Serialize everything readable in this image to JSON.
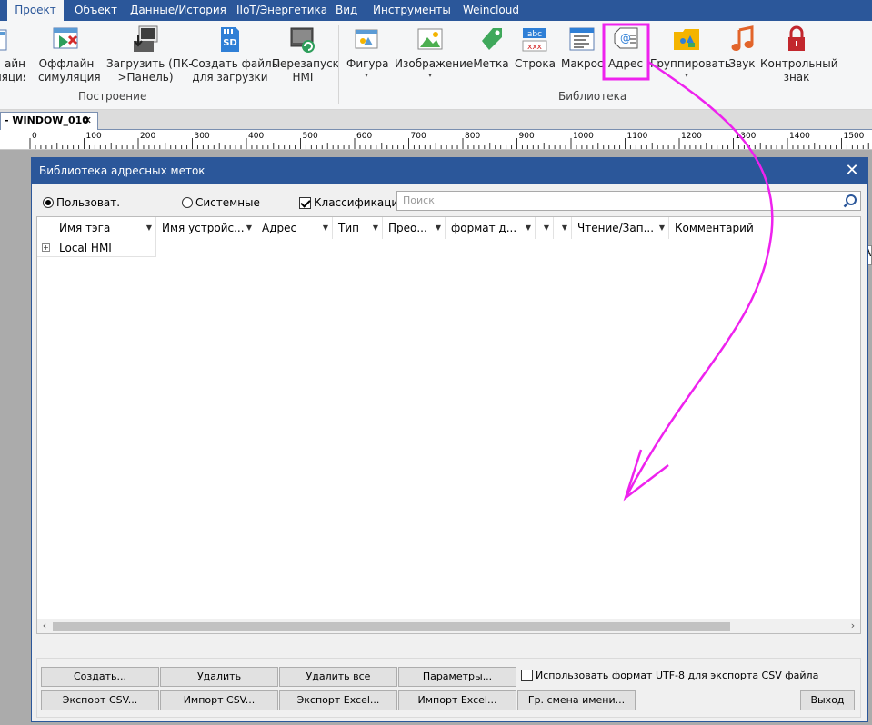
{
  "menu": {
    "items": [
      "Проект",
      "Объект",
      "Данные/История",
      "IIoT/Энергетика",
      "Вид",
      "Инструменты",
      "Weincloud"
    ],
    "active_index": 0
  },
  "ribbon": {
    "build_group": {
      "label": "Построение",
      "buttons": [
        {
          "line1": "айн",
          "line2": "ляция",
          "icon": "online-simulation-icon"
        },
        {
          "line1": "Оффлайн",
          "line2": "симуляция",
          "icon": "offline-simulation-icon"
        },
        {
          "line1": "Загрузить (ПК-",
          "line2": ">Панель)",
          "icon": "download-icon"
        },
        {
          "line1": "Создать файлы",
          "line2": "для загрузки",
          "icon": "sd-card-icon"
        },
        {
          "line1": "Перезапуск",
          "line2": "HMI",
          "icon": "restart-hmi-icon"
        }
      ]
    },
    "library_group": {
      "label": "Библиотека",
      "buttons": [
        {
          "line1": "Фигура",
          "line2": "",
          "icon": "shape-icon",
          "has_dropdown": true
        },
        {
          "line1": "Изображение",
          "line2": "",
          "icon": "picture-icon",
          "has_dropdown": true
        },
        {
          "line1": "Метка",
          "line2": "",
          "icon": "tag-icon",
          "has_dropdown": false
        },
        {
          "line1": "Строка",
          "line2": "",
          "icon": "string-icon",
          "has_dropdown": false
        },
        {
          "line1": "Макрос",
          "line2": "",
          "icon": "macro-icon",
          "has_dropdown": false
        },
        {
          "line1": "Адрес",
          "line2": "",
          "icon": "address-icon",
          "has_dropdown": false,
          "highlighted": true
        },
        {
          "line1": "Группировать",
          "line2": "",
          "icon": "group-icon",
          "has_dropdown": true
        },
        {
          "line1": "Звук",
          "line2": "",
          "icon": "sound-icon",
          "has_dropdown": false
        },
        {
          "line1": "Контрольный",
          "line2": "знак",
          "icon": "lock-icon",
          "has_dropdown": false
        }
      ]
    },
    "dropdown_arrow": "▾"
  },
  "tabstrip": {
    "doc_tab_label": "- WINDOW_010",
    "doc_tab_close": "✕"
  },
  "ruler": {
    "marks": [
      "0",
      "100",
      "200",
      "300",
      "400",
      "500",
      "600",
      "700",
      "800",
      "900",
      "1000",
      "1100",
      "1200",
      "1300",
      "1400",
      "1500"
    ]
  },
  "canvas_edge_text": "A",
  "dialog": {
    "title": "Библиотека адресных меток",
    "close_glyph": "✕",
    "radio_user": "Пользоват.",
    "radio_system": "Системные",
    "radio_selected": "user",
    "classification_label": "Классификация",
    "classification_checked": true,
    "search_placeholder": "Поиск",
    "columns": [
      {
        "label": "Имя тэга"
      },
      {
        "label": "Имя устройс..."
      },
      {
        "label": "Адрес"
      },
      {
        "label": "Тип"
      },
      {
        "label": "Прео..."
      },
      {
        "label": "формат д..."
      },
      {
        "label": ""
      },
      {
        "label": ""
      },
      {
        "label": "Чтение/Зап..."
      },
      {
        "label": "Комментарий"
      }
    ],
    "tree_root": "Local HMI",
    "tree_expand_glyph": "+",
    "scroll_left": "‹",
    "scroll_right": "›",
    "buttons_row1": [
      "Создать...",
      "Удалить",
      "Удалить все",
      "Параметры..."
    ],
    "buttons_row2": [
      "Экспорт CSV...",
      "Импорт CSV...",
      "Экспорт Excel...",
      "Импорт Excel...",
      "Гр. смена имени..."
    ],
    "utf8_label": "Использовать формат UTF-8 для экспорта CSV файла",
    "utf8_checked": false,
    "exit_label": "Выход"
  },
  "colors": {
    "menu_bg": "#2b579a",
    "annotation": "#ee22ee",
    "highlight_box": "#ee22ee"
  }
}
